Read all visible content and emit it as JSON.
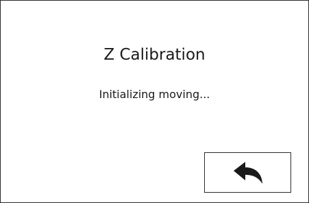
{
  "screen": {
    "title": "Z Calibration",
    "message": "Initializing moving..."
  },
  "back_button": {
    "icon": "back-arrow-icon"
  },
  "colors": {
    "background": "#ffffff",
    "border": "#2a2a2a",
    "text": "#1a1a1a"
  }
}
